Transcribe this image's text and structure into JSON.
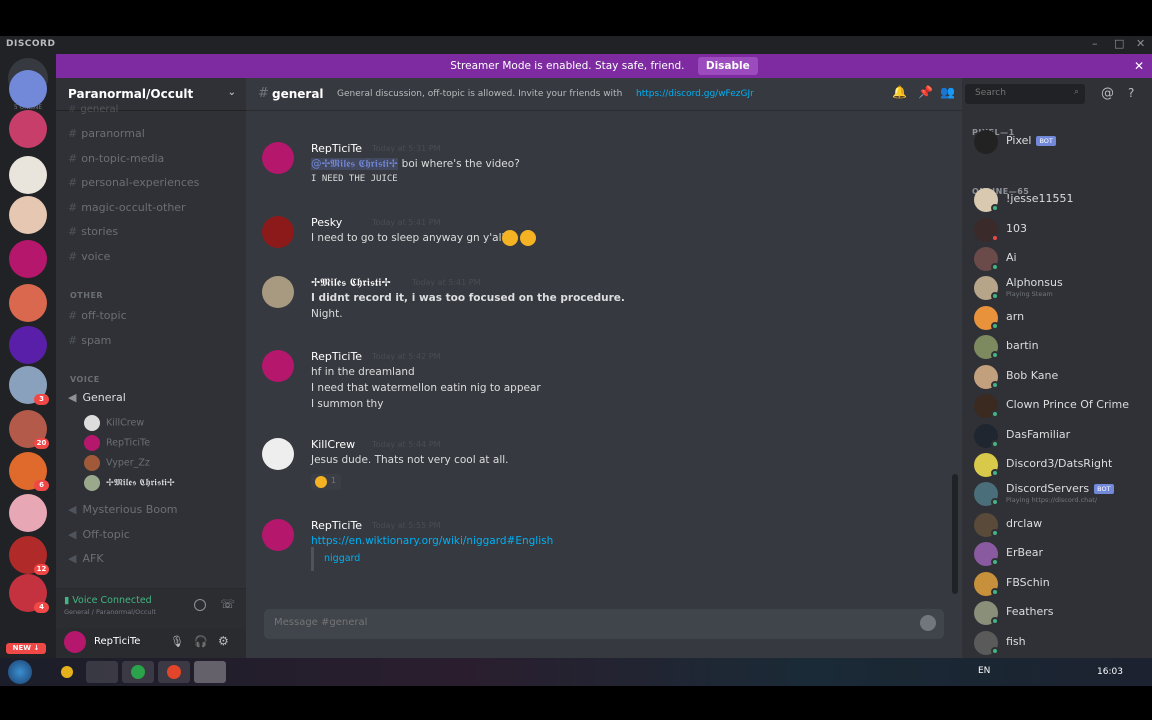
{
  "app": {
    "brand": "DISCORD",
    "window_controls": [
      "–",
      "□",
      "✕"
    ]
  },
  "banner": {
    "text": "Streamer Mode is enabled. Stay safe, friend.",
    "button": "Disable",
    "close": "✕"
  },
  "guilds": {
    "online_label": "5 ONLINE",
    "items": [
      {
        "color": "#7289da",
        "badge": ""
      },
      {
        "color": "#c83e6b",
        "badge": ""
      },
      {
        "color": "#e9e4dc",
        "badge": ""
      },
      {
        "color": "#e6c7b2",
        "badge": ""
      },
      {
        "color": "#b5176d",
        "badge": ""
      },
      {
        "color": "#d9684f",
        "badge": ""
      },
      {
        "color": "#5a1fa8",
        "badge": ""
      },
      {
        "color": "#8aa1bd",
        "badge": "3"
      },
      {
        "color": "#b35a4b",
        "badge": "20"
      },
      {
        "color": "#e06a2c",
        "badge": "6"
      },
      {
        "color": "#e7a7b5",
        "badge": ""
      },
      {
        "color": "#b02a2a",
        "badge": "12"
      },
      {
        "color": "#c4323f",
        "badge": "4"
      }
    ],
    "new_badge": "NEW ↓"
  },
  "server": {
    "name": "Paranormal/Occult",
    "chevron": "⌄"
  },
  "channels": {
    "partial": "general",
    "text": [
      "paranormal",
      "on-topic-media",
      "personal-experiences",
      "magic-occult-other",
      "stories",
      "voice"
    ],
    "other_category": "OTHER",
    "other": [
      "off-topic",
      "spam"
    ],
    "voice_category": "VOICE",
    "voice_general": "General",
    "voice_users": [
      {
        "name": "KillCrew",
        "color": "#ddd"
      },
      {
        "name": "RepTiciTe",
        "color": "#b5176d"
      },
      {
        "name": "Vyper_Zz",
        "color": "#a05a3a"
      },
      {
        "name": "✢𝕸𝖎𝖑𝖊𝖘 𝕮𝖍𝖗𝖎𝖘𝖙𝖎✢",
        "color": "#9aa98b"
      }
    ],
    "voice_others": [
      "Mysterious Boom",
      "Off-topic",
      "AFK"
    ]
  },
  "voice_connected": {
    "title": "Voice Connected",
    "sub": "General / Paranormal/Occult"
  },
  "user": {
    "name": "RepTiciTe",
    "color": "#b5176d"
  },
  "channel_header": {
    "name": "general",
    "topic": "General discussion, off-topic is allowed. Invite your friends with",
    "link": "https://discord.gg/wFezGJr",
    "search_placeholder": "Search"
  },
  "messages": [
    {
      "author": "RepTiciTe",
      "time": "Today at 5:31 PM",
      "color": "#b5176d",
      "mention": "@✢𝕸𝖎𝖑𝖊𝖘 𝕮𝖍𝖗𝖎𝖘𝖙𝖎✢",
      "lines": [
        "boi where's the video?",
        "I NEED THE JUICE"
      ]
    },
    {
      "author": "Pesky",
      "time": "Today at 5:41 PM",
      "color": "#8c1a1a",
      "lines": [
        "I need to go to sleep anyway gn y'all"
      ]
    },
    {
      "author": "✢𝕸𝖎𝖑𝖊𝖘 𝕮𝖍𝖗𝖎𝖘𝖙𝖎✢",
      "time": "Today at 5:41 PM",
      "color": "#a89a80",
      "lines": [
        "I didnt record it, i was too focused on the procedure.",
        "Night."
      ]
    },
    {
      "author": "RepTiciTe",
      "time": "Today at 5:42 PM",
      "color": "#b5176d",
      "lines": [
        "hf in the dreamland",
        "I need that watermellon eatin nig to appear",
        "I summon thy"
      ]
    },
    {
      "author": "KillCrew",
      "time": "Today at 5:44 PM",
      "color": "#eeeeee",
      "lines": [
        "Jesus dude. Thats not very cool at all."
      ],
      "reaction": "1"
    },
    {
      "author": "RepTiciTe",
      "time": "Today at 5:55 PM",
      "color": "#b5176d",
      "link": "https://en.wiktionary.org/wiki/niggard#English",
      "embed": "niggard"
    }
  ],
  "composer": {
    "placeholder": "Message #general"
  },
  "members": {
    "bots_heading": "PIXEL—1",
    "online_heading": "ONLINE—65",
    "bot_label": "BOT",
    "list": [
      {
        "name": "Pixel",
        "bot": true,
        "color": "#222",
        "status": "",
        "sub": ""
      },
      {
        "name": "!jesse11551",
        "color": "#d9c9b0",
        "status": "#43b581",
        "sub": ""
      },
      {
        "name": "103",
        "color": "#3a2a2a",
        "status": "#f04747",
        "sub": ""
      },
      {
        "name": "Ai",
        "color": "#6b4a4a",
        "status": "#43b581",
        "sub": ""
      },
      {
        "name": "Alphonsus",
        "color": "#b7a58a",
        "status": "#43b581",
        "sub": "Playing Steam"
      },
      {
        "name": "arn",
        "color": "#e8923b",
        "status": "#43b581",
        "sub": ""
      },
      {
        "name": "bartin",
        "color": "#7d8a5f",
        "status": "#43b581",
        "sub": ""
      },
      {
        "name": "Bob Kane",
        "color": "#c3a07d",
        "status": "#43b581",
        "sub": ""
      },
      {
        "name": "Clown Prince Of Crime",
        "color": "#3a2a20",
        "status": "#43b581",
        "sub": ""
      },
      {
        "name": "DasFamiliar",
        "color": "#1f2630",
        "status": "#43b581",
        "sub": ""
      },
      {
        "name": "Discord3/DatsRight",
        "color": "#d9c94a",
        "status": "#43b581",
        "sub": ""
      },
      {
        "name": "DiscordServers",
        "bot": true,
        "color": "#4a6e7a",
        "status": "#43b581",
        "sub": "Playing https://discord.chat/"
      },
      {
        "name": "drclaw",
        "color": "#5a4a3a",
        "status": "#43b581",
        "sub": ""
      },
      {
        "name": "ErBear",
        "color": "#8a5aa0",
        "status": "#43b581",
        "sub": ""
      },
      {
        "name": "FBSchin",
        "color": "#c7913b",
        "status": "#43b581",
        "sub": ""
      },
      {
        "name": "Feathers",
        "color": "#8a8f7a",
        "status": "#43b581",
        "sub": ""
      },
      {
        "name": "fish",
        "color": "#5a5a5a",
        "status": "#43b581",
        "sub": ""
      }
    ]
  },
  "taskbar": {
    "lang": "EN",
    "time": "16:03"
  }
}
